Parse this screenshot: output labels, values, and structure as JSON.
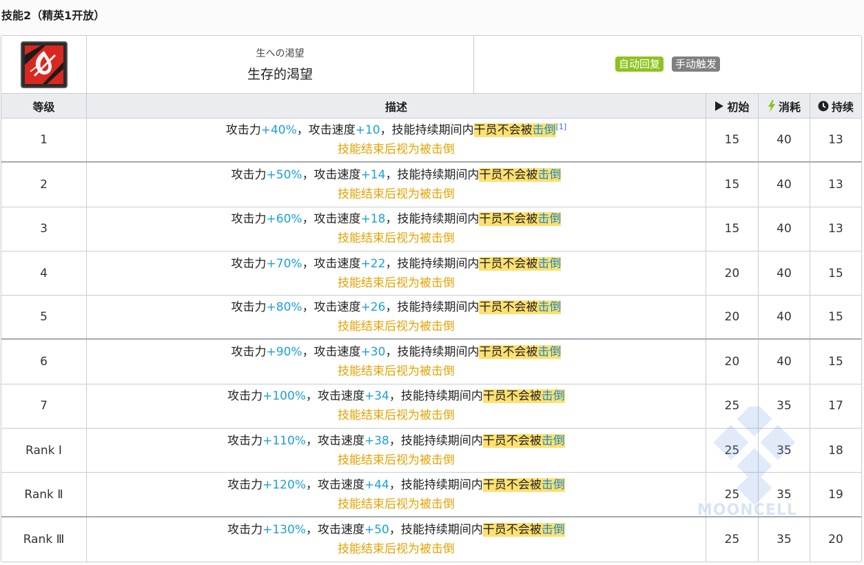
{
  "section_title": "技能2（精英1开放）",
  "skill": {
    "name_jp": "生への渇望",
    "name_cn": "生存的渴望",
    "tags": [
      "自动回复",
      "手动触发"
    ],
    "tag_colors": {
      "auto": "#8ec31f",
      "manual": "#808080"
    }
  },
  "headers": {
    "level": "等级",
    "desc": "描述",
    "initial": "初始",
    "cost": "消耗",
    "duration": "持续"
  },
  "desc_text": {
    "atk_label": "攻击力",
    "aspd_label": "，攻击速度",
    "mid": "，技能持续期间内",
    "highlight": "干员不会被",
    "highlight_link": "击倒",
    "line2": "技能结束后视为被击倒",
    "footnote": "[1]"
  },
  "rows": [
    {
      "level": "1",
      "atk": "+40%",
      "aspd": "+10",
      "initial": "15",
      "cost": "40",
      "duration": "13"
    },
    {
      "level": "2",
      "atk": "+50%",
      "aspd": "+14",
      "initial": "15",
      "cost": "40",
      "duration": "13"
    },
    {
      "level": "3",
      "atk": "+60%",
      "aspd": "+18",
      "initial": "15",
      "cost": "40",
      "duration": "13"
    },
    {
      "level": "4",
      "atk": "+70%",
      "aspd": "+22",
      "initial": "20",
      "cost": "40",
      "duration": "15"
    },
    {
      "level": "5",
      "atk": "+80%",
      "aspd": "+26",
      "initial": "20",
      "cost": "40",
      "duration": "15"
    },
    {
      "level": "6",
      "atk": "+90%",
      "aspd": "+30",
      "initial": "20",
      "cost": "40",
      "duration": "15"
    },
    {
      "level": "7",
      "atk": "+100%",
      "aspd": "+34",
      "initial": "25",
      "cost": "35",
      "duration": "17"
    },
    {
      "level": "Rank Ⅰ",
      "atk": "+110%",
      "aspd": "+38",
      "initial": "25",
      "cost": "35",
      "duration": "18"
    },
    {
      "level": "Rank Ⅱ",
      "atk": "+120%",
      "aspd": "+44",
      "initial": "25",
      "cost": "35",
      "duration": "19"
    },
    {
      "level": "Rank Ⅲ",
      "atk": "+130%",
      "aspd": "+50",
      "initial": "25",
      "cost": "35",
      "duration": "20"
    }
  ],
  "watermark": "MOONCELL",
  "icons": {
    "skill": "skill-icon",
    "initial": "play-icon",
    "cost": "lightning-icon",
    "duration": "clock-icon"
  },
  "colors": {
    "value_blue": "#1aa0d8",
    "note_orange": "#e6a200",
    "highlight_yellow": "#ffe070",
    "cost_green": "#8ec31f"
  }
}
